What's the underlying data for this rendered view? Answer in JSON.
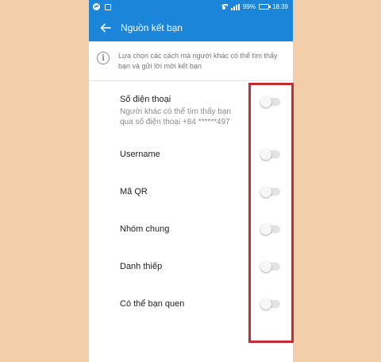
{
  "status_bar": {
    "battery": "99%",
    "time": "18:39",
    "icons": [
      "messenger-icon",
      "notification-square-icon",
      "wifi-icon",
      "signal-icon",
      "battery-icon"
    ]
  },
  "header": {
    "title": "Nguồn kết bạn",
    "back_icon": "arrow-left-icon"
  },
  "info": {
    "icon": "info-icon",
    "text": "Lựa chọn các cách mà người khác có thể tìm thấy bạn và gửi lời mời kết bạn"
  },
  "settings": [
    {
      "label": "Số điện thoại",
      "description_line1": "Người khác có thể tìm thấy bạn",
      "description_line2": "qua số điện thoại +84 ******497",
      "enabled": false
    },
    {
      "label": "Username",
      "enabled": false
    },
    {
      "label": "Mã QR",
      "enabled": false
    },
    {
      "label": "Nhóm chung",
      "enabled": false
    },
    {
      "label": "Danh thiếp",
      "enabled": false
    },
    {
      "label": "Có thể bạn quen",
      "enabled": false
    }
  ],
  "colors": {
    "app_bar": "#1b86d9",
    "background": "#f2ceaa",
    "highlight": "#c62d33",
    "toggle_off_track": "#e3e3e3"
  }
}
